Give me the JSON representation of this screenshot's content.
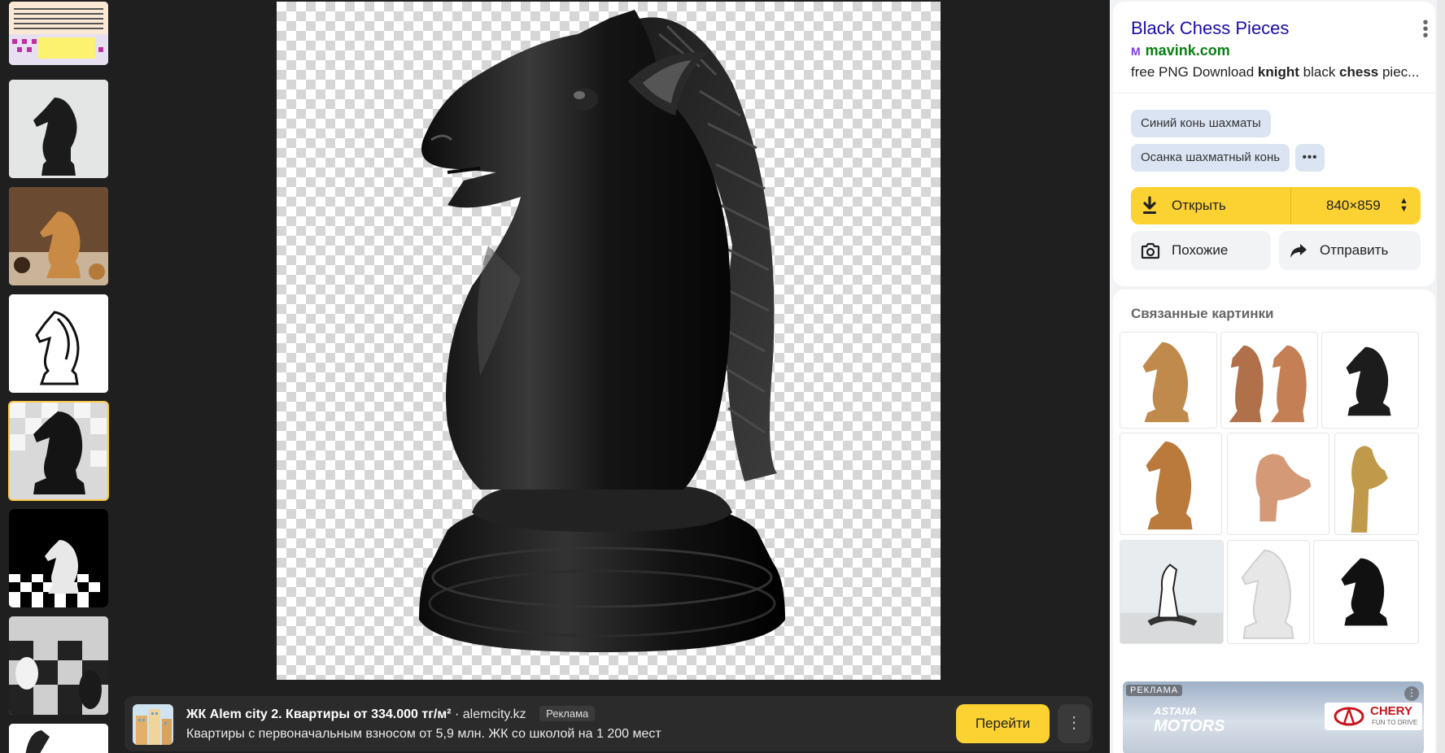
{
  "result": {
    "title": "Black Chess Pieces",
    "site_icon_letter": "M",
    "site": "mavink.com",
    "description_parts": [
      "free PNG Download ",
      "knight",
      " black ",
      "chess",
      " piec..."
    ]
  },
  "chips": [
    "Синий конь шахматы",
    "Осанка шахматный конь",
    "•••"
  ],
  "actions": {
    "open_label": "Открыть",
    "size": "840×859",
    "similar_label": "Похожие",
    "send_label": "Отправить"
  },
  "related": {
    "title": "Связанные картинки"
  },
  "ad": {
    "title": "ЖК Alem city 2. Квартиры от 334.000 тг/м²",
    "domain": "alemcity.kz",
    "badge": "Реклама",
    "text": "Квартиры с первоначальным взносом от 5,9 млн. ЖК со школой на 1 200 мест",
    "button_label": "Перейти",
    "more_label": "⋮"
  },
  "side_ad": {
    "badge": "РЕКЛАМА",
    "brand_top": "ASTANA",
    "brand_bottom": "MOTORS",
    "car_brand": "CHERY",
    "car_slogan": "FUN TO DRIVE",
    "more_label": "⋮"
  },
  "colors": {
    "accent_yellow": "#fcd232",
    "link_blue": "#1a0dab",
    "site_green": "#0a7f12",
    "chip_bg": "#dbe4f3"
  }
}
